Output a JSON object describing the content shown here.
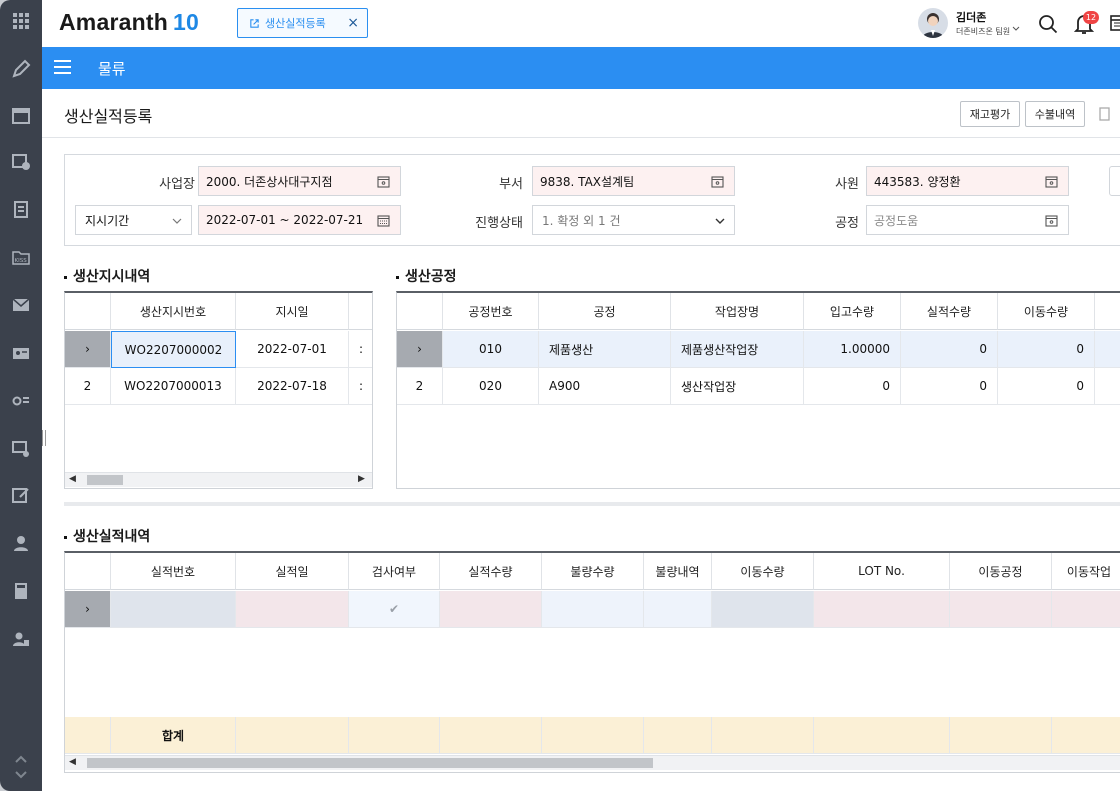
{
  "app": {
    "logo_text": "Amaranth",
    "logo_version": "10",
    "accent": "#2b8ef2"
  },
  "tab": {
    "label": "생산실적등록",
    "close": "×"
  },
  "user": {
    "name": "김더존",
    "org": "더존비즈온 팀원",
    "notifications": "12"
  },
  "menu": {
    "title": "물류"
  },
  "page": {
    "title": "생산실적등록",
    "buttons": [
      "재고평가",
      "수불내역"
    ]
  },
  "search": {
    "biz_label": "사업장",
    "biz_value": "2000. 더존상사대구지점",
    "dept_label": "부서",
    "dept_value": "9838. TAX설계팀",
    "emp_label": "사원",
    "emp_value": "443583. 양정환",
    "period_select": "지시기간",
    "period_value": "2022-07-01 ~ 2022-07-21",
    "status_label": "진행상태",
    "status_value": "1. 확정 외 1 건",
    "process_label": "공정",
    "process_placeholder": "공정도움"
  },
  "orders": {
    "title": "생산지시내역",
    "columns": [
      "",
      "생산지시번호",
      "지시일",
      ""
    ],
    "rows": [
      {
        "idx": "›",
        "no": "WO2207000002",
        "date": "2022-07-01",
        "extra": ":"
      },
      {
        "idx": "2",
        "no": "WO2207000013",
        "date": "2022-07-18",
        "extra": ":"
      }
    ]
  },
  "process": {
    "title": "생산공정",
    "columns": [
      "",
      "공정번호",
      "공정",
      "작업장명",
      "입고수량",
      "실적수량",
      "이동수량"
    ],
    "rows": [
      {
        "idx": "›",
        "code": "010",
        "name": "제품생산",
        "workplace": "제품생산작업장",
        "in_qty": "1.00000",
        "result_qty": "0",
        "move_qty": "0"
      },
      {
        "idx": "2",
        "code": "020",
        "name": "A900",
        "workplace": "생산작업장",
        "in_qty": "0",
        "result_qty": "0",
        "move_qty": "0"
      }
    ]
  },
  "results": {
    "title": "생산실적내역",
    "columns": [
      "",
      "실적번호",
      "실적일",
      "검사여부",
      "실적수량",
      "불량수량",
      "불량내역",
      "이동수량",
      "LOT No.",
      "이동공정",
      "이동작업"
    ],
    "first_row_idx": "›",
    "check": "✔",
    "total_label": "합계"
  }
}
